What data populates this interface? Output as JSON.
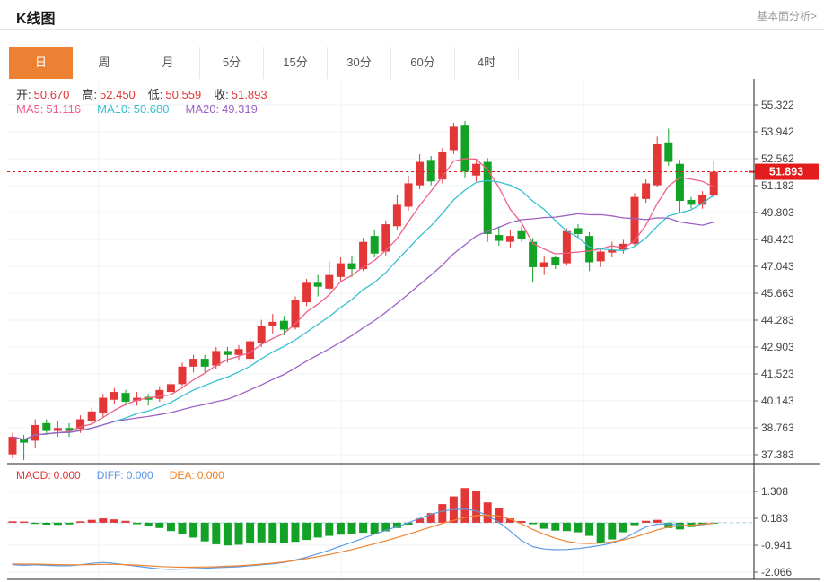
{
  "header": {
    "title": "K线图",
    "link": "基本面分析>"
  },
  "tabs": {
    "items": [
      "日",
      "周",
      "月",
      "5分",
      "15分",
      "30分",
      "60分",
      "4时"
    ],
    "active": "日"
  },
  "ohlc_bar": {
    "open_label": "开:",
    "open": "50.670",
    "high_label": "高:",
    "high": "52.450",
    "low_label": "低:",
    "low": "50.559",
    "close_label": "收:",
    "close": "51.893"
  },
  "ma_bar": {
    "ma5_label": "MA5:",
    "ma5": "51.116",
    "ma10_label": "MA10:",
    "ma10": "50.680",
    "ma20_label": "MA20:",
    "ma20": "49.319"
  },
  "macd_bar": {
    "macd_label": "MACD:",
    "macd": "0.000",
    "diff_label": "DIFF:",
    "diff": "0.000",
    "dea_label": "DEA:",
    "dea": "0.000"
  },
  "price_marker": {
    "label": "51.893",
    "price": 51.893
  },
  "colors": {
    "accent_tab": "#ec8033",
    "up": "#e33636",
    "down": "#12a226",
    "ma5": "#ee5f88",
    "ma10": "#35c0d0",
    "ma20": "#9d62c4",
    "diff_line": "#5e9be6",
    "dea_line": "#ee8433",
    "marker_red": "#e31b1b",
    "grid": "#edf2f6",
    "axis": "#222222",
    "tick_label": "#444444",
    "zero_dash": "#a9cfe5",
    "ohlc_value": "#e33636",
    "diff_text": "#5b93e8",
    "dea_text": "#ee8022"
  },
  "chart_data": [
    {
      "type": "candlestick",
      "panel": "main",
      "legend": [
        "MA5",
        "MA10",
        "MA20"
      ],
      "ma_periods": [
        5,
        10,
        20
      ],
      "y_ticks": [
        55.322,
        53.942,
        52.562,
        51.182,
        49.803,
        48.423,
        47.043,
        45.663,
        44.283,
        42.903,
        41.523,
        40.143,
        38.763,
        37.383
      ],
      "ylim": [
        36.2,
        56.6
      ],
      "last_close": 51.893,
      "ohlc": [
        [
          37.4,
          38.5,
          37.2,
          38.3
        ],
        [
          38.2,
          38.4,
          37.1,
          38.0
        ],
        [
          38.1,
          39.2,
          37.7,
          38.9
        ],
        [
          39.0,
          39.2,
          38.4,
          38.6
        ],
        [
          38.6,
          39.1,
          38.3,
          38.75
        ],
        [
          38.75,
          39.0,
          38.3,
          38.6
        ],
        [
          38.7,
          39.4,
          38.5,
          39.2
        ],
        [
          39.1,
          39.8,
          38.9,
          39.6
        ],
        [
          39.5,
          40.5,
          39.3,
          40.3
        ],
        [
          40.2,
          40.8,
          40.0,
          40.6
        ],
        [
          40.55,
          40.7,
          39.9,
          40.1
        ],
        [
          40.15,
          40.6,
          39.9,
          40.3
        ],
        [
          40.35,
          40.5,
          39.9,
          40.2
        ],
        [
          40.25,
          40.9,
          40.1,
          40.7
        ],
        [
          40.6,
          41.2,
          40.4,
          41.0
        ],
        [
          41.0,
          42.1,
          40.9,
          41.9
        ],
        [
          41.9,
          42.5,
          41.6,
          42.3
        ],
        [
          42.3,
          42.5,
          41.6,
          41.9
        ],
        [
          41.95,
          42.9,
          41.8,
          42.7
        ],
        [
          42.7,
          42.9,
          42.1,
          42.5
        ],
        [
          42.5,
          43.0,
          42.2,
          42.8
        ],
        [
          42.3,
          43.4,
          42.0,
          43.2
        ],
        [
          43.1,
          44.3,
          42.9,
          44.0
        ],
        [
          44.0,
          44.6,
          43.6,
          44.2
        ],
        [
          44.25,
          44.5,
          43.5,
          43.8
        ],
        [
          43.9,
          45.5,
          43.8,
          45.3
        ],
        [
          45.2,
          46.4,
          45.0,
          46.2
        ],
        [
          46.2,
          46.6,
          45.5,
          46.0
        ],
        [
          45.9,
          47.3,
          45.8,
          46.6
        ],
        [
          46.5,
          47.5,
          46.3,
          47.2
        ],
        [
          47.2,
          47.6,
          46.5,
          46.9
        ],
        [
          46.9,
          48.5,
          46.8,
          48.3
        ],
        [
          48.6,
          48.9,
          47.5,
          47.7
        ],
        [
          47.8,
          49.4,
          47.6,
          49.2
        ],
        [
          49.1,
          50.7,
          48.9,
          50.2
        ],
        [
          50.1,
          51.7,
          49.9,
          51.3
        ],
        [
          51.2,
          52.8,
          51.0,
          52.4
        ],
        [
          52.5,
          52.7,
          51.2,
          51.4
        ],
        [
          51.5,
          53.1,
          51.3,
          52.9
        ],
        [
          53.0,
          54.4,
          52.8,
          54.2
        ],
        [
          54.3,
          54.5,
          51.6,
          51.9
        ],
        [
          51.7,
          52.5,
          51.4,
          52.3
        ],
        [
          52.4,
          52.6,
          48.3,
          48.7
        ],
        [
          48.65,
          49.1,
          48.1,
          48.35
        ],
        [
          48.3,
          48.9,
          48.0,
          48.6
        ],
        [
          48.85,
          49.1,
          48.3,
          48.45
        ],
        [
          48.3,
          48.5,
          46.2,
          47.0
        ],
        [
          47.0,
          47.6,
          46.6,
          47.25
        ],
        [
          47.5,
          47.6,
          46.9,
          47.1
        ],
        [
          47.2,
          49.0,
          47.1,
          48.85
        ],
        [
          49.0,
          49.2,
          48.5,
          48.7
        ],
        [
          48.6,
          48.8,
          46.8,
          47.25
        ],
        [
          47.3,
          48.0,
          47.0,
          47.8
        ],
        [
          47.75,
          48.3,
          47.5,
          47.9
        ],
        [
          47.9,
          48.4,
          47.7,
          48.2
        ],
        [
          48.2,
          50.8,
          48.1,
          50.6
        ],
        [
          50.5,
          51.5,
          50.3,
          51.3
        ],
        [
          51.2,
          53.7,
          51.1,
          53.3
        ],
        [
          53.4,
          54.1,
          52.2,
          52.4
        ],
        [
          52.3,
          52.5,
          49.8,
          50.4
        ],
        [
          50.45,
          50.6,
          50.0,
          50.2
        ],
        [
          50.2,
          50.9,
          50.0,
          50.7
        ],
        [
          50.67,
          52.45,
          50.559,
          51.893
        ]
      ]
    },
    {
      "type": "bar",
      "panel": "macd",
      "y_ticks": [
        1.308,
        0.183,
        -0.941,
        -2.066
      ],
      "histogram": [
        0.06,
        0.05,
        -0.05,
        -0.08,
        -0.09,
        -0.07,
        0.06,
        0.12,
        0.18,
        0.14,
        0.08,
        -0.06,
        -0.12,
        -0.22,
        -0.35,
        -0.48,
        -0.62,
        -0.78,
        -0.9,
        -0.95,
        -0.92,
        -0.86,
        -0.82,
        -0.84,
        -0.86,
        -0.8,
        -0.72,
        -0.62,
        -0.55,
        -0.5,
        -0.46,
        -0.42,
        -0.46,
        -0.36,
        -0.22,
        -0.08,
        0.18,
        0.4,
        0.78,
        1.1,
        1.45,
        1.32,
        0.85,
        0.62,
        0.18,
        0.07,
        -0.06,
        -0.25,
        -0.33,
        -0.35,
        -0.4,
        -0.55,
        -0.83,
        -0.7,
        -0.4,
        -0.1,
        0.08,
        0.12,
        -0.22,
        -0.28,
        -0.18,
        -0.08,
        -0.02
      ],
      "series": [
        {
          "name": "DIFF",
          "values": [
            -1.75,
            -1.78,
            -1.76,
            -1.78,
            -1.8,
            -1.8,
            -1.76,
            -1.7,
            -1.66,
            -1.7,
            -1.76,
            -1.82,
            -1.88,
            -1.93,
            -1.95,
            -1.94,
            -1.92,
            -1.9,
            -1.88,
            -1.86,
            -1.84,
            -1.8,
            -1.76,
            -1.72,
            -1.66,
            -1.56,
            -1.44,
            -1.3,
            -1.15,
            -0.98,
            -0.82,
            -0.65,
            -0.48,
            -0.32,
            -0.16,
            0.0,
            0.18,
            0.35,
            0.48,
            0.55,
            0.57,
            0.5,
            0.3,
            0.02,
            -0.35,
            -0.75,
            -1.0,
            -1.1,
            -1.13,
            -1.12,
            -1.08,
            -1.02,
            -0.95,
            -0.85,
            -0.68,
            -0.42,
            -0.18,
            -0.06,
            -0.04,
            -0.1,
            -0.13,
            -0.08,
            -0.02
          ]
        },
        {
          "name": "DEA",
          "values": [
            -1.72,
            -1.73,
            -1.73,
            -1.74,
            -1.75,
            -1.76,
            -1.76,
            -1.75,
            -1.74,
            -1.74,
            -1.75,
            -1.77,
            -1.8,
            -1.83,
            -1.85,
            -1.86,
            -1.86,
            -1.85,
            -1.84,
            -1.82,
            -1.8,
            -1.77,
            -1.73,
            -1.69,
            -1.64,
            -1.58,
            -1.5,
            -1.42,
            -1.33,
            -1.23,
            -1.12,
            -1.0,
            -0.88,
            -0.75,
            -0.62,
            -0.48,
            -0.33,
            -0.18,
            -0.03,
            0.1,
            0.22,
            0.3,
            0.32,
            0.28,
            0.15,
            -0.05,
            -0.28,
            -0.48,
            -0.65,
            -0.78,
            -0.85,
            -0.87,
            -0.85,
            -0.8,
            -0.72,
            -0.6,
            -0.45,
            -0.3,
            -0.18,
            -0.12,
            -0.1,
            -0.06,
            -0.02
          ]
        }
      ]
    }
  ]
}
